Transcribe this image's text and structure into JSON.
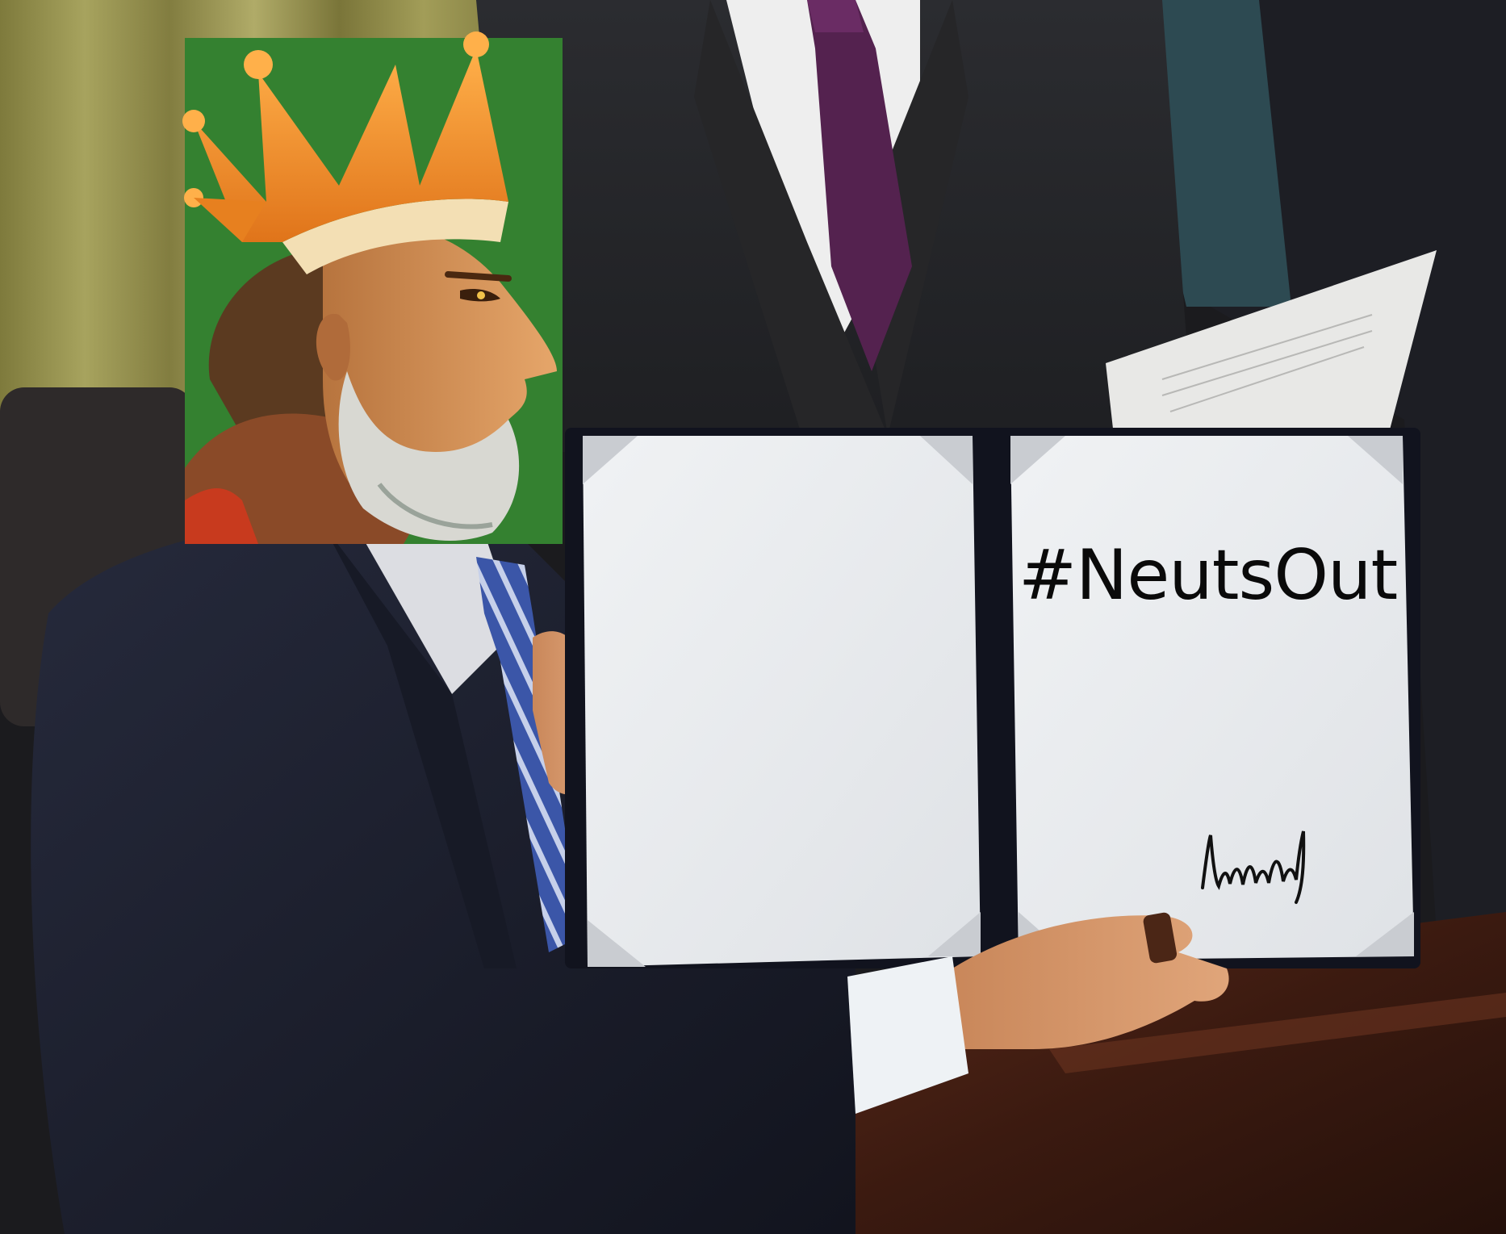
{
  "meme": {
    "caption": "#NeutsOut",
    "signature_label": "signature"
  },
  "colors": {
    "curtain": "#8f8a4a",
    "suit": "#1c1f2e",
    "desk": "#3a1c14",
    "folder": "#121420",
    "paper": "#e6e9ec",
    "portrait_bg": "#2d7a2a",
    "crown": "#f08a1c"
  }
}
